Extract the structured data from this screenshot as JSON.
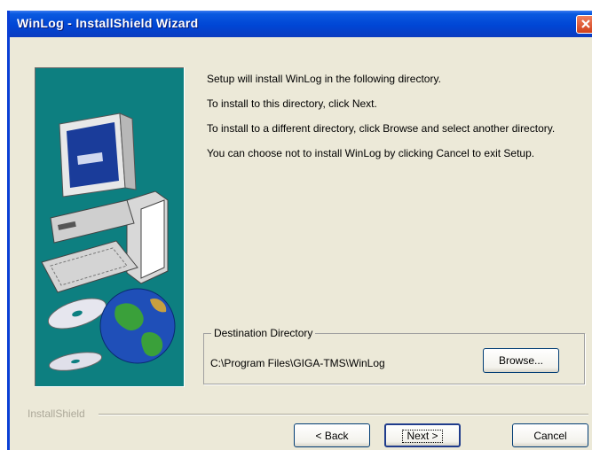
{
  "window": {
    "title": "WinLog - InstallShield Wizard"
  },
  "body": {
    "paragraphs": [
      "Setup will install WinLog in the following directory.",
      "To install to this directory, click Next.",
      "To install to a different directory, click Browse and select another directory.",
      "You can choose not to install WinLog by clicking Cancel to exit Setup."
    ]
  },
  "destination": {
    "legend": "Destination Directory",
    "path": "C:\\Program Files\\GIGA-TMS\\WinLog",
    "browse_label": "Browse..."
  },
  "footer": {
    "brand": "InstallShield",
    "back_label": "< Back",
    "next_label": "Next >",
    "cancel_label": "Cancel"
  },
  "colors": {
    "titlebar": "#0046d5",
    "panel_art_bg": "#0d7f80",
    "dialog_bg": "#ece9d8"
  },
  "icons": [
    "close-icon",
    "computer-icon",
    "cd-icon",
    "globe-icon"
  ]
}
